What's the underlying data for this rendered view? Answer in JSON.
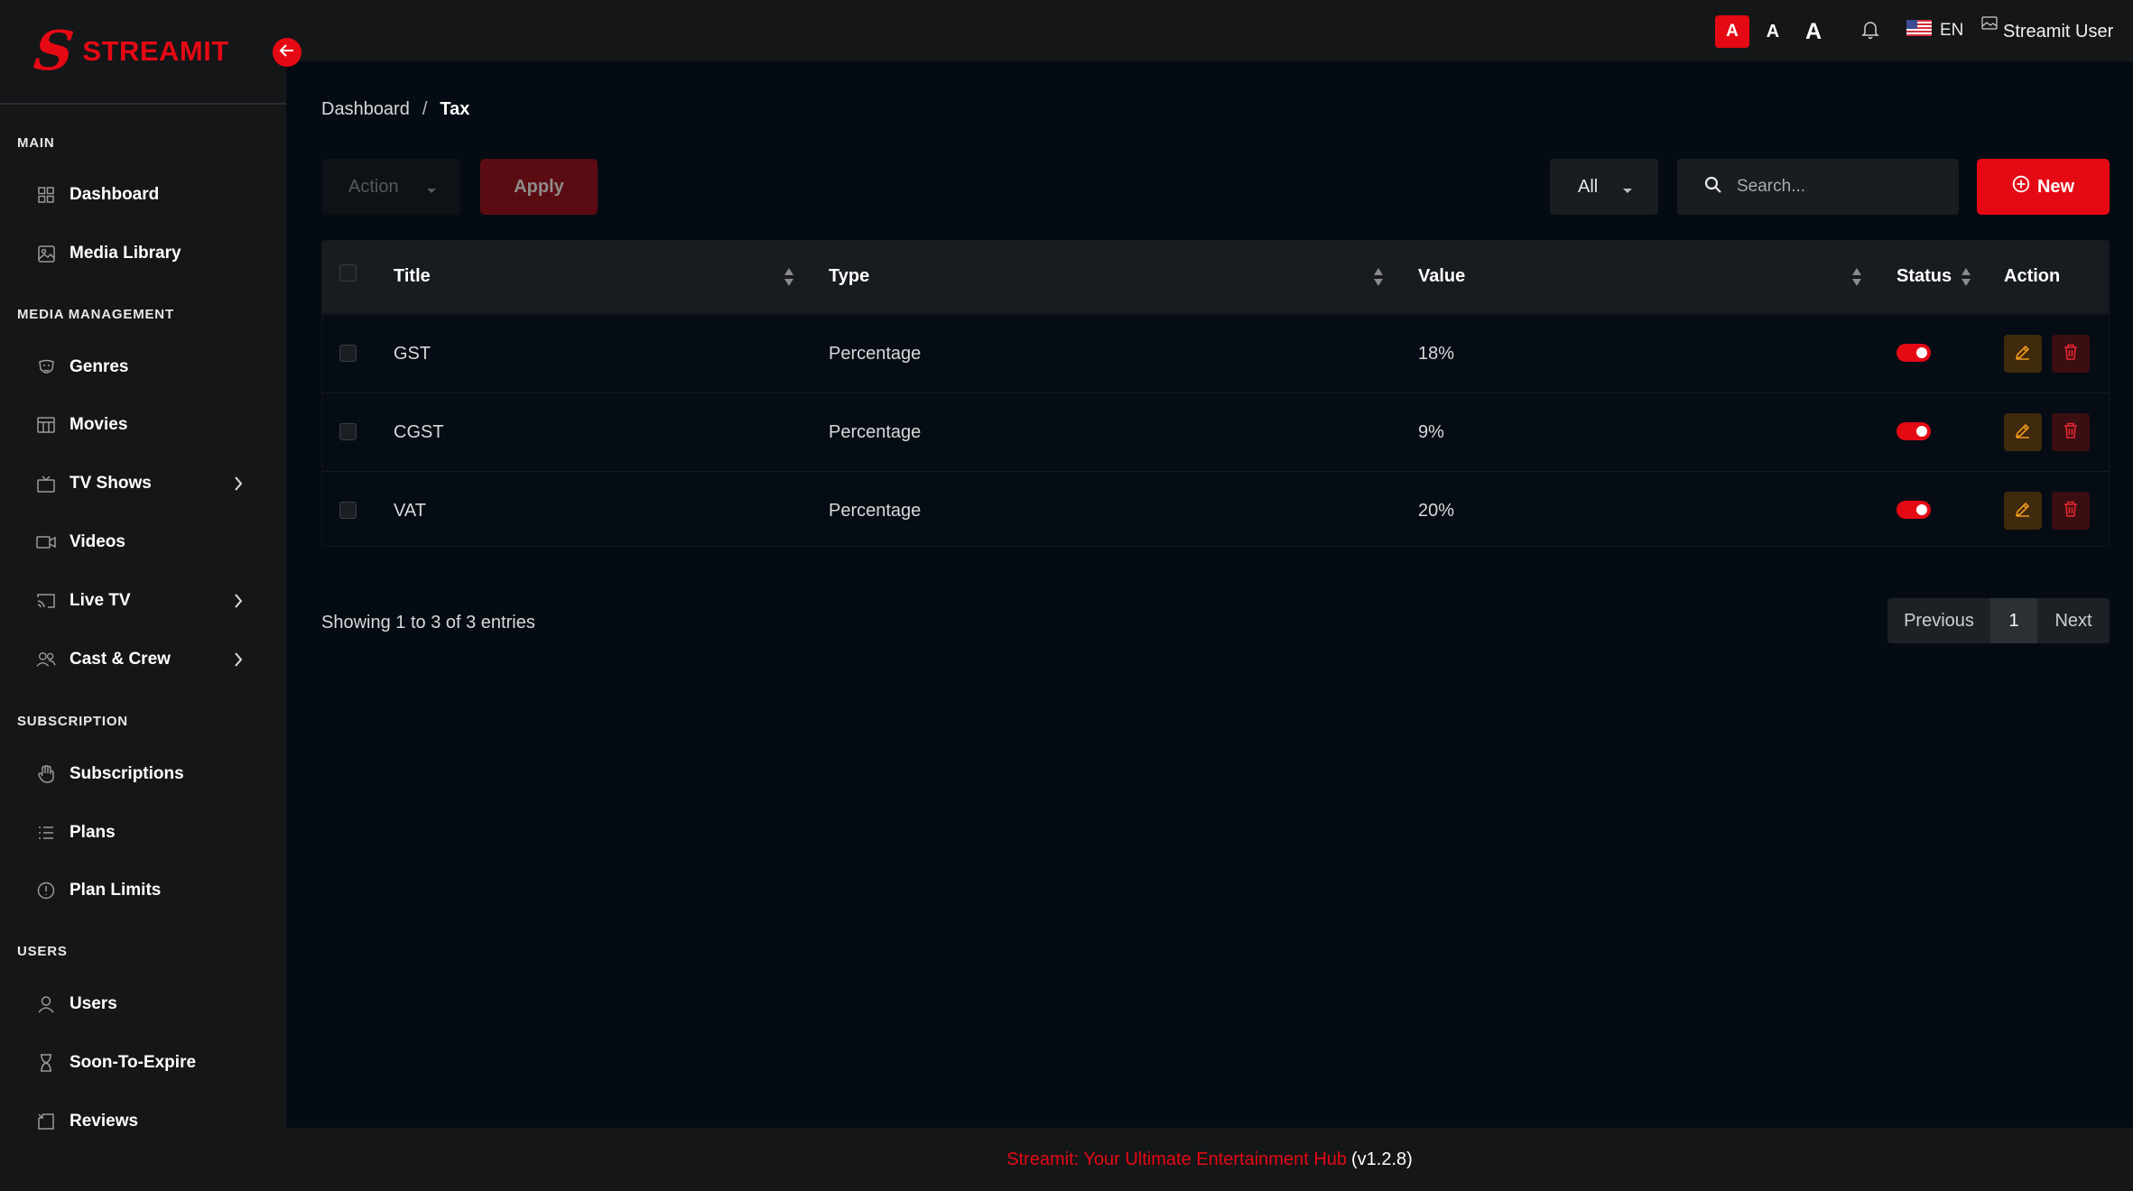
{
  "brand": {
    "logo_letter": "S",
    "name": "STREAMIT",
    "accent": "#e50914"
  },
  "sidebar": {
    "sections": [
      {
        "label": "MAIN"
      },
      {
        "label": "MEDIA MANAGEMENT"
      },
      {
        "label": "SUBSCRIPTION"
      },
      {
        "label": "USERS"
      }
    ],
    "items": [
      {
        "label": "Dashboard",
        "icon": "dashboard-icon"
      },
      {
        "label": "Media Library",
        "icon": "image-icon"
      },
      {
        "label": "Genres",
        "icon": "mask-icon"
      },
      {
        "label": "Movies",
        "icon": "film-icon"
      },
      {
        "label": "TV Shows",
        "icon": "tv-icon"
      },
      {
        "label": "Videos",
        "icon": "video-camera-icon"
      },
      {
        "label": "Live TV",
        "icon": "cast-icon"
      },
      {
        "label": "Cast & Crew",
        "icon": "users-icon"
      },
      {
        "label": "Subscriptions",
        "icon": "hand-icon"
      },
      {
        "label": "Plans",
        "icon": "list-icon"
      },
      {
        "label": "Plan Limits",
        "icon": "info-circle-icon"
      },
      {
        "label": "Users",
        "icon": "user-icon"
      },
      {
        "label": "Soon-To-Expire",
        "icon": "hourglass-icon"
      },
      {
        "label": "Reviews",
        "icon": "review-icon"
      }
    ]
  },
  "header": {
    "font_sizes": [
      "A",
      "A",
      "A"
    ],
    "language": "EN",
    "user_name": "Streamit User"
  },
  "breadcrumb": {
    "parent": "Dashboard",
    "separator": "/",
    "current": "Tax"
  },
  "toolbar": {
    "action_placeholder": "Action",
    "apply_label": "Apply",
    "filter_value": "All",
    "search_placeholder": "Search...",
    "new_label": "New"
  },
  "table": {
    "columns": [
      "Title",
      "Type",
      "Value",
      "Status",
      "Action"
    ],
    "rows": [
      {
        "title": "GST",
        "type": "Percentage",
        "value": "18%",
        "status": true
      },
      {
        "title": "CGST",
        "type": "Percentage",
        "value": "9%",
        "status": true
      },
      {
        "title": "VAT",
        "type": "Percentage",
        "value": "20%",
        "status": true
      }
    ]
  },
  "pagination": {
    "info": "Showing 1 to 3 of 3 entries",
    "previous": "Previous",
    "current_page": "1",
    "next": "Next"
  },
  "footer": {
    "brand_text": "Streamit: Your Ultimate Entertainment Hub",
    "version": "(v1.2.8)"
  }
}
